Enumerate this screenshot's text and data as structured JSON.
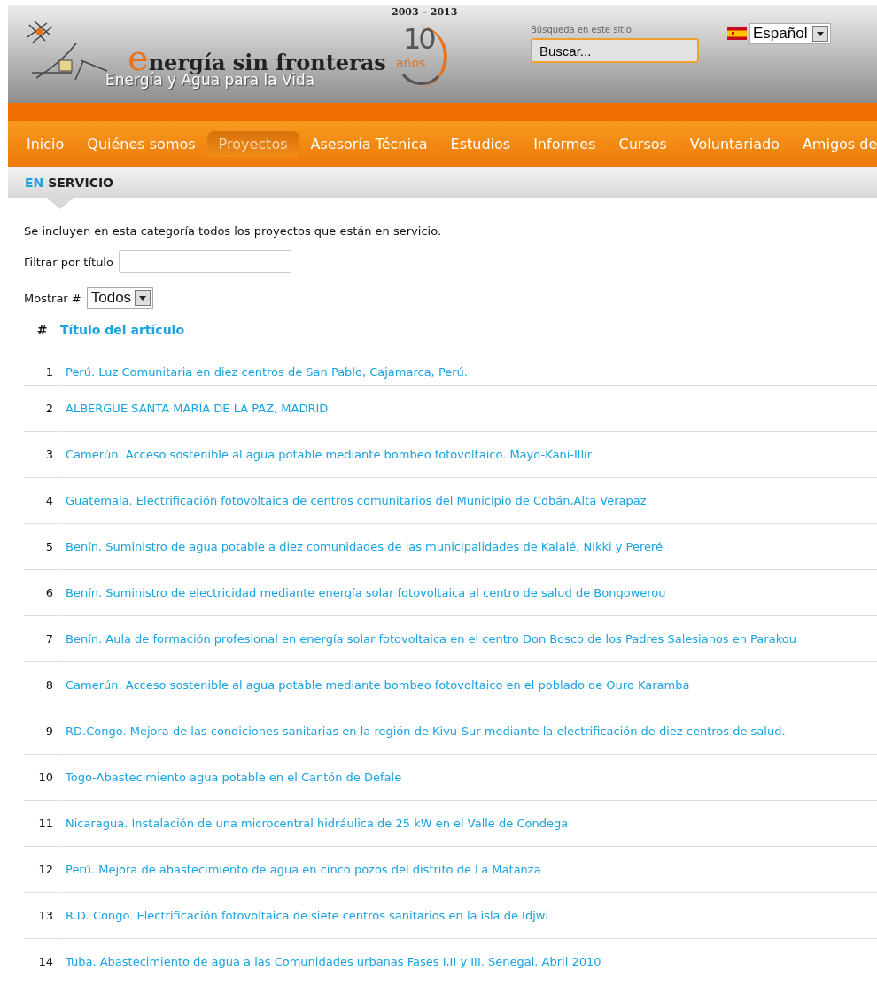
{
  "header": {
    "logo_initial": "e",
    "logo_rest": "nergía sin fronteras",
    "tagline": "Energía y Agua para la Vida",
    "anniversary_years": "2003 – 2013",
    "anniversary_number": "10",
    "anniversary_word": "años",
    "search_label": "Búsqueda en este sitio",
    "search_value": "Buscar...",
    "language": "Español"
  },
  "nav": [
    {
      "label": "Inicio",
      "selected": false
    },
    {
      "label": "Quiénes somos",
      "selected": false
    },
    {
      "label": "Proyectos",
      "selected": true
    },
    {
      "label": "Asesoría Técnica",
      "selected": false
    },
    {
      "label": "Estudios",
      "selected": false
    },
    {
      "label": "Informes",
      "selected": false
    },
    {
      "label": "Cursos",
      "selected": false
    },
    {
      "label": "Voluntariado",
      "selected": false
    },
    {
      "label": "Amigos de",
      "selected": false
    }
  ],
  "breadcrumb": {
    "prefix": "EN",
    "title": "SERVICIO"
  },
  "intro": "Se incluyen en esta categoría todos los proyectos que están en servicio.",
  "filter": {
    "label": "Filtrar por título"
  },
  "display": {
    "label": "Mostrar #",
    "value": "Todos"
  },
  "table": {
    "columns": [
      "#",
      "Título del artículo"
    ],
    "rows": [
      {
        "number": "1",
        "title": "Perú. Luz Comunitaria en diez centros de San Pablo, Cajamarca, Perú."
      },
      {
        "number": "2",
        "title": "ALBERGUE SANTA MARÍA DE LA PAZ, MADRID"
      },
      {
        "number": "3",
        "title": "Camerún. Acceso sostenible al agua potable mediante bombeo fotovoltaico. Mayo-Kani-Illir"
      },
      {
        "number": "4",
        "title": "Guatemala. Electrificación fotovoltaica de centros comunitarios del Municipio de Cobán,Alta Verapaz"
      },
      {
        "number": "5",
        "title": "Benín. Suministro de agua potable a diez comunidades de las municipalidades de Kalalé, Nikki y Pereré"
      },
      {
        "number": "6",
        "title": "Benín. Suministro de electricidad mediante energía solar fotovoltaica al centro de salud de Bongowerou"
      },
      {
        "number": "7",
        "title": "Benín. Aula de formación profesional en energía solar fotovoltaica en el centro Don Bosco de los Padres Salesianos en Parakou"
      },
      {
        "number": "8",
        "title": "Camerún. Acceso sostenible al agua potable mediante bombeo fotovoltaico en el poblado de Ouro Karamba"
      },
      {
        "number": "9",
        "title": "RD.Congo. Mejora de las condiciones sanitarias en la región de Kivu-Sur mediante la electrificación de diez centros de salud."
      },
      {
        "number": "10",
        "title": "Togo-Abastecimiento agua potable en el Cantón de Defale"
      },
      {
        "number": "11",
        "title": "Nicaragua. Instalación de una microcentral hidráulica de 25 kW en el Valle de Condega"
      },
      {
        "number": "12",
        "title": "Perú. Mejora de abastecimiento de agua en cinco pozos del distrito de La Matanza"
      },
      {
        "number": "13",
        "title": "R.D. Congo. Electrificación fotovoltaica de siete centros sanitarios en la isla de Idjwi"
      },
      {
        "number": "14",
        "title": "Tuba. Abastecimiento de agua a las Comunidades urbanas Fases I,II y III. Senegal. Abril 2010"
      }
    ]
  }
}
